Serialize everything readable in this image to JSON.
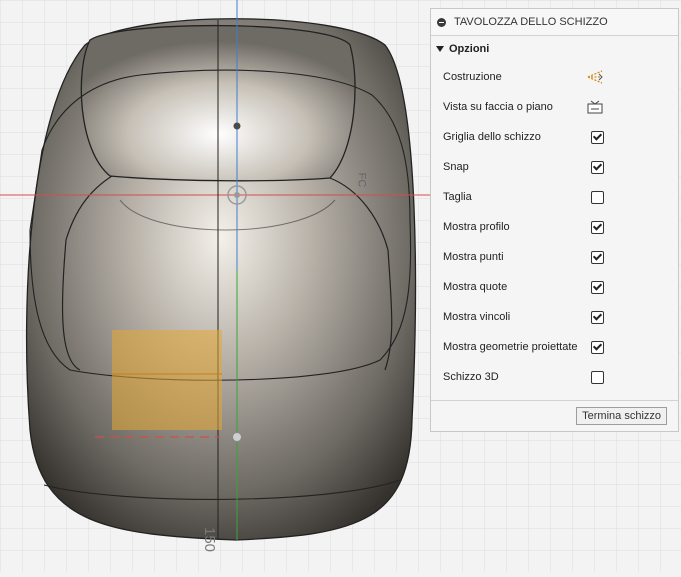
{
  "palette": {
    "background": "#f3f3f3",
    "grid": "#dedede",
    "axis_blue": "#3f7fcf",
    "axis_red": "#d44d4d",
    "axis_green": "#3aa43a",
    "selection_fill": "#e6a733",
    "panel_bg": "#f5f5f5",
    "accent_orange": "#d08a16"
  },
  "viewport": {
    "ruler_label": "150",
    "side_label": "FC"
  },
  "panel": {
    "title": "TAVOLOZZA DELLO SCHIZZO",
    "section": "Opzioni",
    "rows": [
      {
        "label": "Costruzione",
        "control": "icon",
        "icon": "construction-icon"
      },
      {
        "label": "Vista su faccia o piano",
        "control": "icon",
        "icon": "look-at-icon"
      },
      {
        "label": "Griglia dello schizzo",
        "control": "checkbox",
        "checked": true
      },
      {
        "label": "Snap",
        "control": "checkbox",
        "checked": true
      },
      {
        "label": "Taglia",
        "control": "checkbox",
        "checked": false
      },
      {
        "label": "Mostra profilo",
        "control": "checkbox",
        "checked": true
      },
      {
        "label": "Mostra punti",
        "control": "checkbox",
        "checked": true
      },
      {
        "label": "Mostra quote",
        "control": "checkbox",
        "checked": true
      },
      {
        "label": "Mostra vincoli",
        "control": "checkbox",
        "checked": true
      },
      {
        "label": "Mostra geometrie proiettate",
        "control": "checkbox",
        "checked": true
      },
      {
        "label": "Schizzo 3D",
        "control": "checkbox",
        "checked": false
      }
    ],
    "finish_button": "Termina schizzo"
  }
}
